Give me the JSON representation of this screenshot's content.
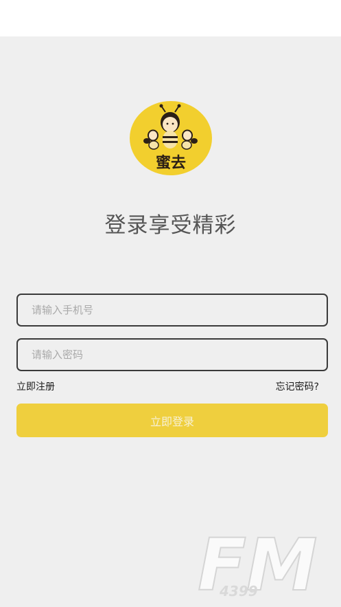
{
  "app": {
    "logo_text": "蜜去",
    "title": "登录享受精彩"
  },
  "form": {
    "phone_placeholder": "请输入手机号",
    "password_placeholder": "请输入密码",
    "register_label": "立即注册",
    "forgot_label": "忘记密码?",
    "login_label": "立即登录"
  },
  "watermark": {
    "text": "FM",
    "subtext": "4399"
  },
  "colors": {
    "accent": "#efcf3e",
    "background": "#efefef",
    "border": "#3a3a3a"
  }
}
